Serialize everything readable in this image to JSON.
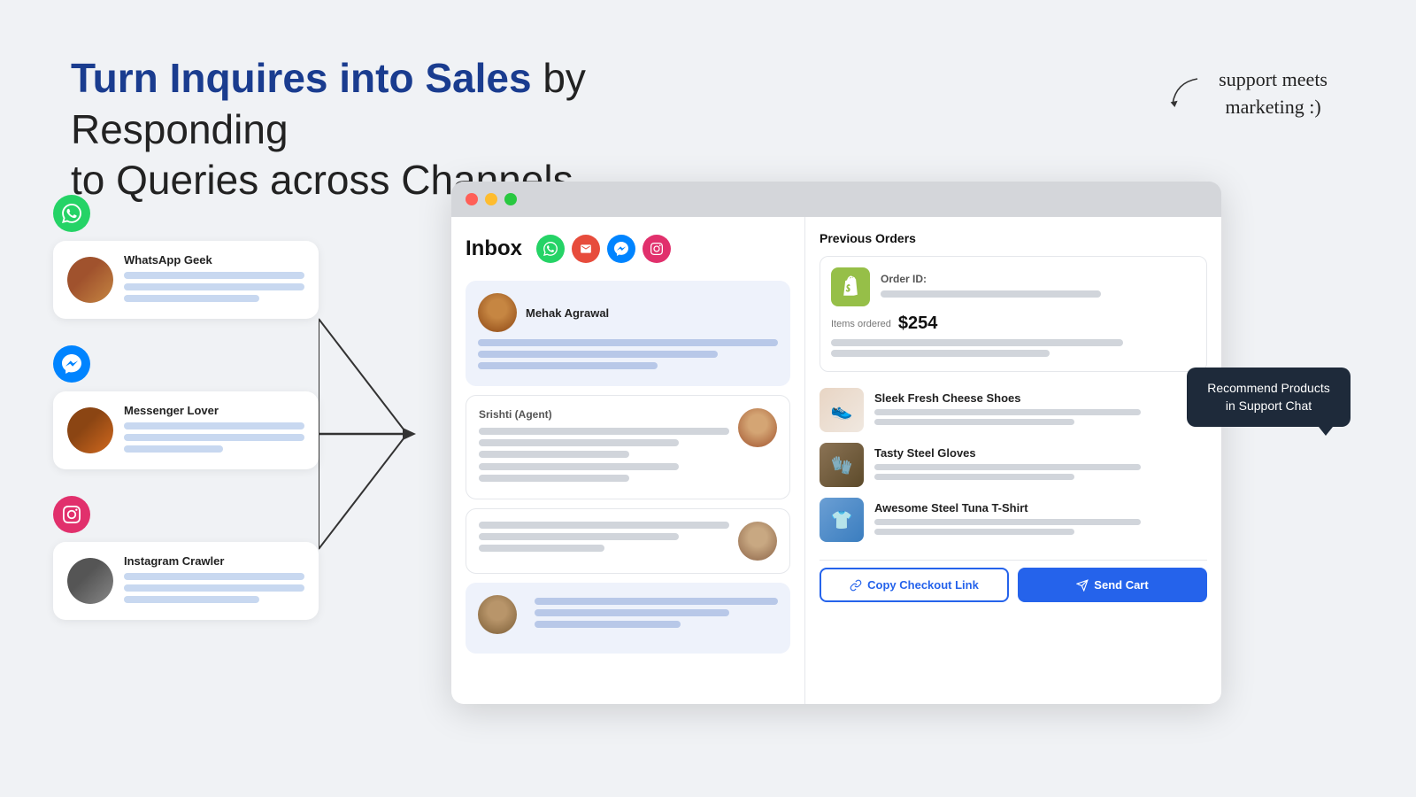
{
  "hero": {
    "title_highlight": "Turn Inquires into Sales",
    "title_rest": " by Responding\nto Queries across Channels"
  },
  "annotation": {
    "line1": "support meets",
    "line2": "marketing :)"
  },
  "channels": [
    {
      "name": "WhatsApp Geek",
      "type": "whatsapp",
      "icon": "📱"
    },
    {
      "name": "Messenger Lover",
      "type": "messenger",
      "icon": "💬"
    },
    {
      "name": "Instagram Crawler",
      "type": "instagram",
      "icon": "📷"
    }
  ],
  "inbox": {
    "title": "Inbox",
    "conversations": [
      {
        "name": "Mehak Agrawal"
      },
      {
        "name": "Srishti (Agent)",
        "is_agent": true
      },
      {
        "name": "",
        "is_agent": true
      },
      {
        "name": ""
      }
    ]
  },
  "right_panel": {
    "previous_orders_label": "Previous Orders",
    "order": {
      "order_id_label": "Order ID:",
      "items_ordered_label": "Items ordered",
      "price": "$254"
    },
    "products": [
      {
        "name": "Sleek Fresh Cheese Shoes"
      },
      {
        "name": "Tasty Steel Gloves"
      },
      {
        "name": "Awesome Steel Tuna T-Shirt"
      }
    ],
    "buttons": {
      "copy_link": "Copy Checkout Link",
      "send_cart": "Send Cart"
    }
  },
  "recommend_bubble": {
    "text": "Recommend Products in Support Chat"
  }
}
